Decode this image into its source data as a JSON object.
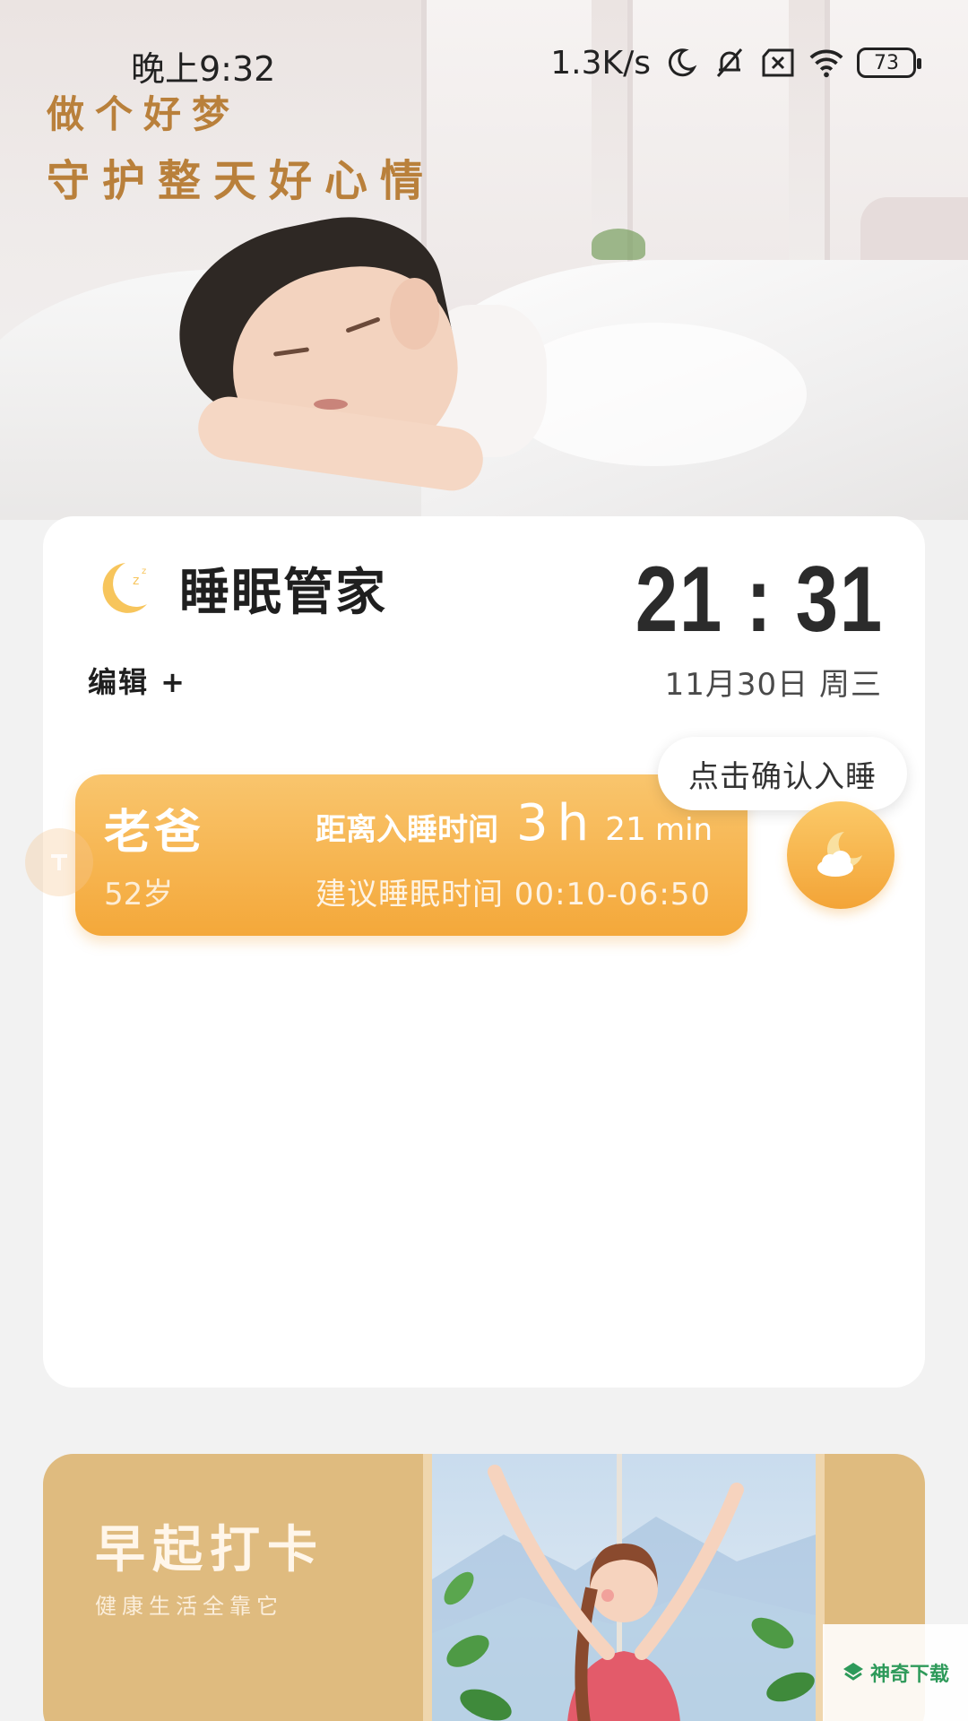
{
  "status_bar": {
    "time": "晚上9:32",
    "net_speed": "1.3K/s",
    "battery": "73",
    "icons": [
      "moon-icon",
      "bell-muted-icon",
      "sim-off-icon",
      "wifi-icon",
      "battery-icon"
    ]
  },
  "hero": {
    "slogan_line1": "做个好梦",
    "slogan_line2": "守护整天好心情"
  },
  "card": {
    "title": "睡眠管家",
    "edit_label": "编辑 +",
    "clock": "21 : 31",
    "date": "11月30日 周三"
  },
  "person": {
    "name": "老爸",
    "age": "52岁",
    "countdown_label": "距离入睡时间",
    "hours": "3",
    "hours_unit": "h",
    "minutes": "21",
    "minutes_unit": "min",
    "suggest": "建议睡眠时间 00:10-06:50"
  },
  "sleep_button": {
    "tooltip": "点击确认入睡"
  },
  "banner": {
    "title": "早起打卡",
    "subtitle": "健康生活全靠它"
  },
  "watermark": {
    "text": "神奇下载"
  },
  "colors": {
    "accent": "#F4A83A",
    "accent_light": "#F9C56D",
    "slogan": "#B9803B",
    "banner_bg": "#DFBB7F"
  }
}
